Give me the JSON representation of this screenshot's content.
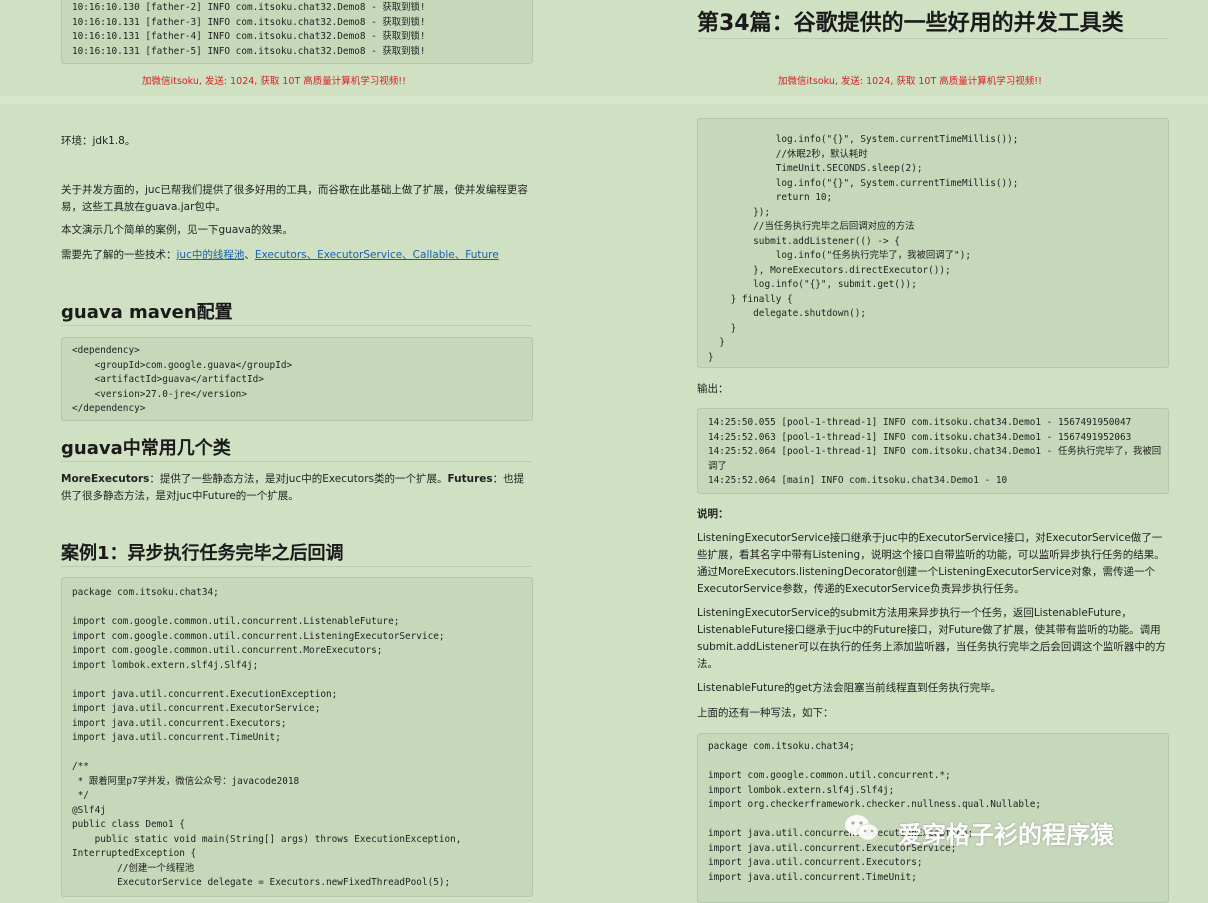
{
  "top_left_log": [
    "10:16:10.130 [father-2] INFO com.itsoku.chat32.Demo8 - 获取到锁!",
    "10:16:10.131 [father-3] INFO com.itsoku.chat32.Demo8 - 获取到锁!",
    "10:16:10.131 [father-4] INFO com.itsoku.chat32.Demo8 - 获取到锁!",
    "10:16:10.131 [father-5] INFO com.itsoku.chat32.Demo8 - 获取到锁!"
  ],
  "promo_text": "加微信itsoku, 发送: 1024, 获取 10T 高质量计算机学习视频!!",
  "right_top_title": "第34篇：谷歌提供的一些好用的并发工具类",
  "left": {
    "env": "环境：jdk1.8。",
    "intro1": "关于并发方面的，juc已帮我们提供了很多好用的工具，而谷歌在此基础上做了扩展，使并发编程更容易，这些工具放在guava.jar包中。",
    "intro2": "本文演示几个简单的案例，见一下guava的效果。",
    "prereq_label": "需要先了解的一些技术：",
    "prereq_link1": "juc中的线程池",
    "prereq_sep": "、",
    "prereq_link2": "Executors、ExecutorService、Callable、Future",
    "h_maven": "guava maven配置",
    "maven_lines": [
      "<dependency>",
      "    <groupId>com.google.guava</groupId>",
      "    <artifactId>guava</artifactId>",
      "    <version>27.0-jre</version>",
      "</dependency>"
    ],
    "h_classes": "guava中常用几个类",
    "classes_text_b1": "MoreExecutors",
    "classes_text_1": "：提供了一些静态方法，是对juc中的Executors类的一个扩展。",
    "classes_text_b2": "Futures",
    "classes_text_2": "：也提供了很多静态方法，是对juc中Future的一个扩展。",
    "h_case1": "案例1：异步执行任务完毕之后回调",
    "case1_code": [
      "package com.itsoku.chat34;",
      "",
      "import com.google.common.util.concurrent.ListenableFuture;",
      "import com.google.common.util.concurrent.ListeningExecutorService;",
      "import com.google.common.util.concurrent.MoreExecutors;",
      "import lombok.extern.slf4j.Slf4j;",
      "",
      "import java.util.concurrent.ExecutionException;",
      "import java.util.concurrent.ExecutorService;",
      "import java.util.concurrent.Executors;",
      "import java.util.concurrent.TimeUnit;",
      "",
      "/**",
      " * 跟着阿里p7学并发，微信公众号：javacode2018",
      " */",
      "@Slf4j",
      "public class Demo1 {",
      "    public static void main(String[] args) throws ExecutionException,",
      "InterruptedException {",
      "        //创建一个线程池",
      "        ExecutorService delegate = Executors.newFixedThreadPool(5);"
    ]
  },
  "right": {
    "code_top": [
      "            log.info(\"{}\", System.currentTimeMillis());",
      "            //休眠2秒，默认耗时",
      "            TimeUnit.SECONDS.sleep(2);",
      "            log.info(\"{}\", System.currentTimeMillis());",
      "            return 10;",
      "        });",
      "        //当任务执行完毕之后回调对应的方法",
      "        submit.addListener(() -> {",
      "            log.info(\"任务执行完毕了，我被回调了\");",
      "        }, MoreExecutors.directExecutor());",
      "        log.info(\"{}\", submit.get());",
      "    } finally {",
      "        delegate.shutdown();",
      "    }",
      "  }",
      "}"
    ],
    "output_label": "输出：",
    "output_lines": [
      "14:25:50.055 [pool-1-thread-1] INFO com.itsoku.chat34.Demo1 - 1567491950047",
      "14:25:52.063 [pool-1-thread-1] INFO com.itsoku.chat34.Demo1 - 1567491952063",
      "14:25:52.064 [pool-1-thread-1] INFO com.itsoku.chat34.Demo1 - 任务执行完毕了，我被回",
      "调了",
      "14:25:52.064 [main] INFO com.itsoku.chat34.Demo1 - 10"
    ],
    "note_label": "说明：",
    "note_p1": "ListeningExecutorService接口继承于juc中的ExecutorService接口，对ExecutorService做了一些扩展，看其名字中带有Listening，说明这个接口自带监听的功能，可以监听异步执行任务的结果。通过MoreExecutors.listeningDecorator创建一个ListeningExecutorService对象，需传递一个ExecutorService参数，传递的ExecutorService负责异步执行任务。",
    "note_p2": "ListeningExecutorService的submit方法用来异步执行一个任务，返回ListenableFuture，ListenableFuture接口继承于juc中的Future接口，对Future做了扩展，使其带有监听的功能。调用submit.addListener可以在执行的任务上添加监听器，当任务执行完毕之后会回调这个监听器中的方法。",
    "note_p3": "ListenableFuture的get方法会阻塞当前线程直到任务执行完毕。",
    "alt_label": "上面的还有一种写法，如下：",
    "code_bottom": [
      "package com.itsoku.chat34;",
      "",
      "import com.google.common.util.concurrent.*;",
      "import lombok.extern.slf4j.Slf4j;",
      "import org.checkerframework.checker.nullness.qual.Nullable;",
      "",
      "import java.util.concurrent.ExecutionException;",
      "import java.util.concurrent.ExecutorService;",
      "import java.util.concurrent.Executors;",
      "import java.util.concurrent.TimeUnit;"
    ]
  },
  "footer_watermark": "爱穿格子衫的程序猿",
  "colors": {
    "background": "#cfe0c3",
    "code_bg": "#c6d7ba",
    "promo": "#d62020",
    "link": "#1b5faa"
  }
}
